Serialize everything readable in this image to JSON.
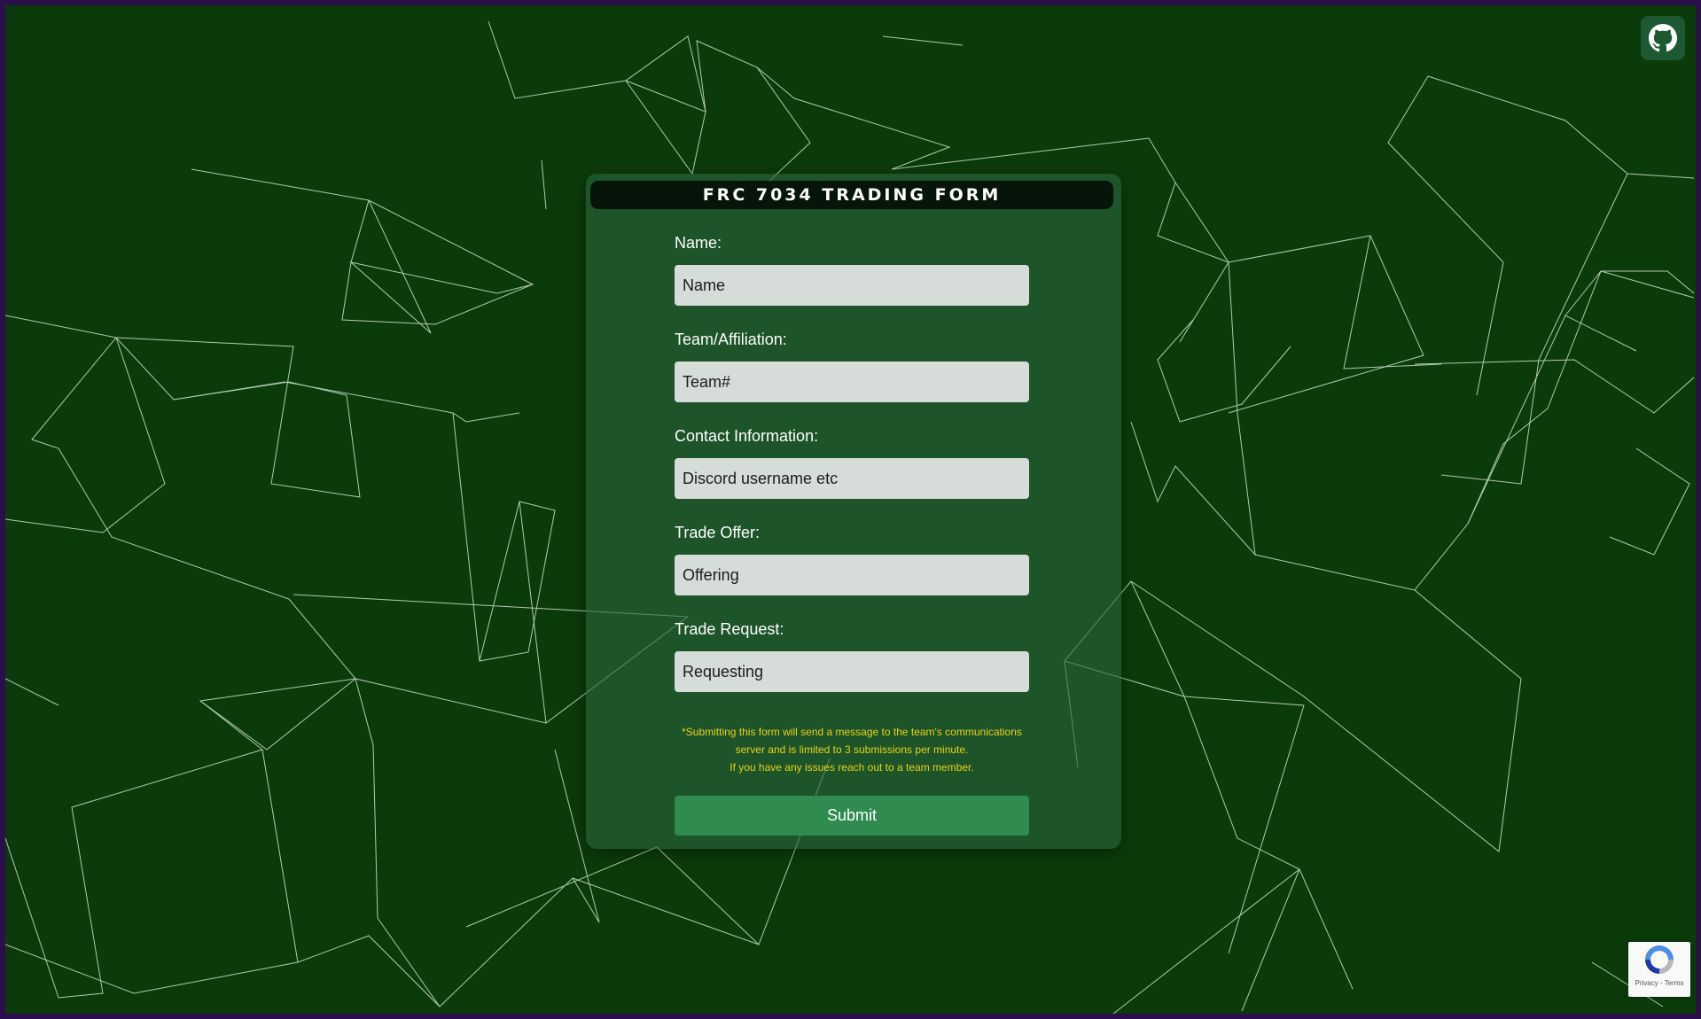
{
  "form": {
    "title": "FRC 7034 Trading Form",
    "fields": [
      {
        "label": "Name:",
        "placeholder": "Name"
      },
      {
        "label": "Team/Affiliation:",
        "placeholder": "Team#"
      },
      {
        "label": "Contact Information:",
        "placeholder": "Discord username etc"
      },
      {
        "label": "Trade Offer:",
        "placeholder": "Offering"
      },
      {
        "label": "Trade Request:",
        "placeholder": "Requesting"
      }
    ],
    "notice": [
      "*Submitting this form will send a message to the team's communications",
      "server and is limited to 3 submissions per minute.",
      "If you have any issues reach out to a team member."
    ],
    "submit_label": "Submit"
  },
  "header": {
    "github_icon": "github-icon"
  },
  "recaptcha": {
    "icon": "recaptcha-icon",
    "links": "Privacy - Terms"
  },
  "colors": {
    "background": "#0b3b0b",
    "border": "#2a0f4a",
    "card": "#28643c",
    "header": "#06140a",
    "input": "#d6dcd8",
    "notice": "#e8d21a",
    "submit": "#2f8b50"
  }
}
